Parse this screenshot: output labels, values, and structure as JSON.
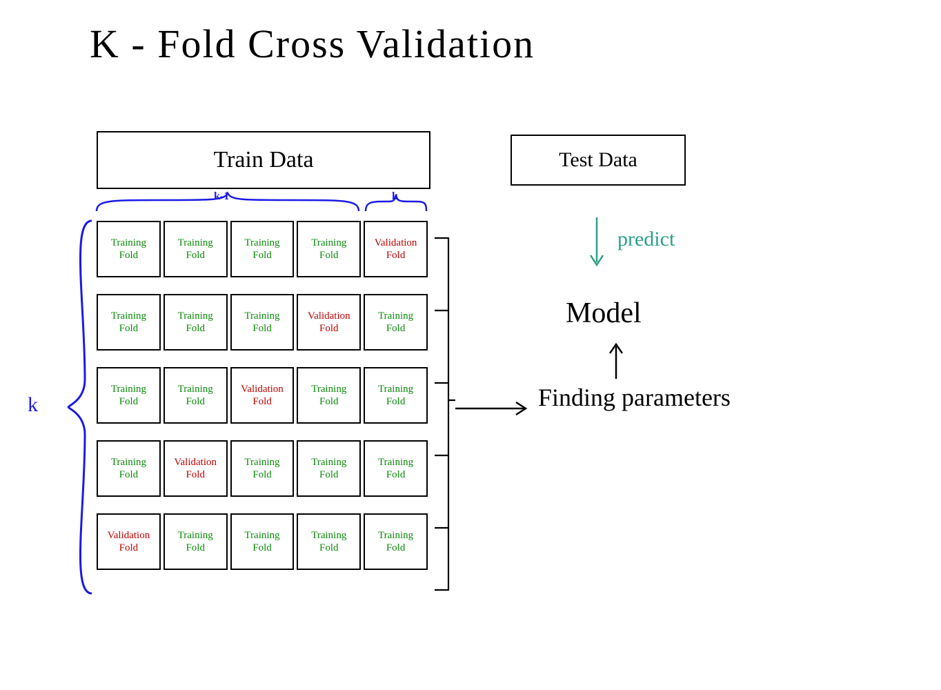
{
  "title": "K - Fold  Cross  Validation",
  "train_label": "Train  Data",
  "test_label": "Test  Data",
  "brace_labels": {
    "k_minus_1": "k-1",
    "k_top": "k",
    "k_left": "k"
  },
  "fold_labels": {
    "training_line1": "Training",
    "training_line2": "Fold",
    "validation_line1": "Validation",
    "validation_line2": "Fold"
  },
  "folds": [
    [
      "training",
      "training",
      "training",
      "training",
      "validation"
    ],
    [
      "training",
      "training",
      "training",
      "validation",
      "training"
    ],
    [
      "training",
      "training",
      "validation",
      "training",
      "training"
    ],
    [
      "training",
      "validation",
      "training",
      "training",
      "training"
    ],
    [
      "validation",
      "training",
      "training",
      "training",
      "training"
    ]
  ],
  "right": {
    "finding": "Finding  parameters",
    "model": "Model",
    "predict": "predict"
  },
  "colors": {
    "training": "#0a8a0a",
    "validation": "#c00000",
    "blue": "#1a1ae6",
    "teal": "#2aa08a"
  }
}
